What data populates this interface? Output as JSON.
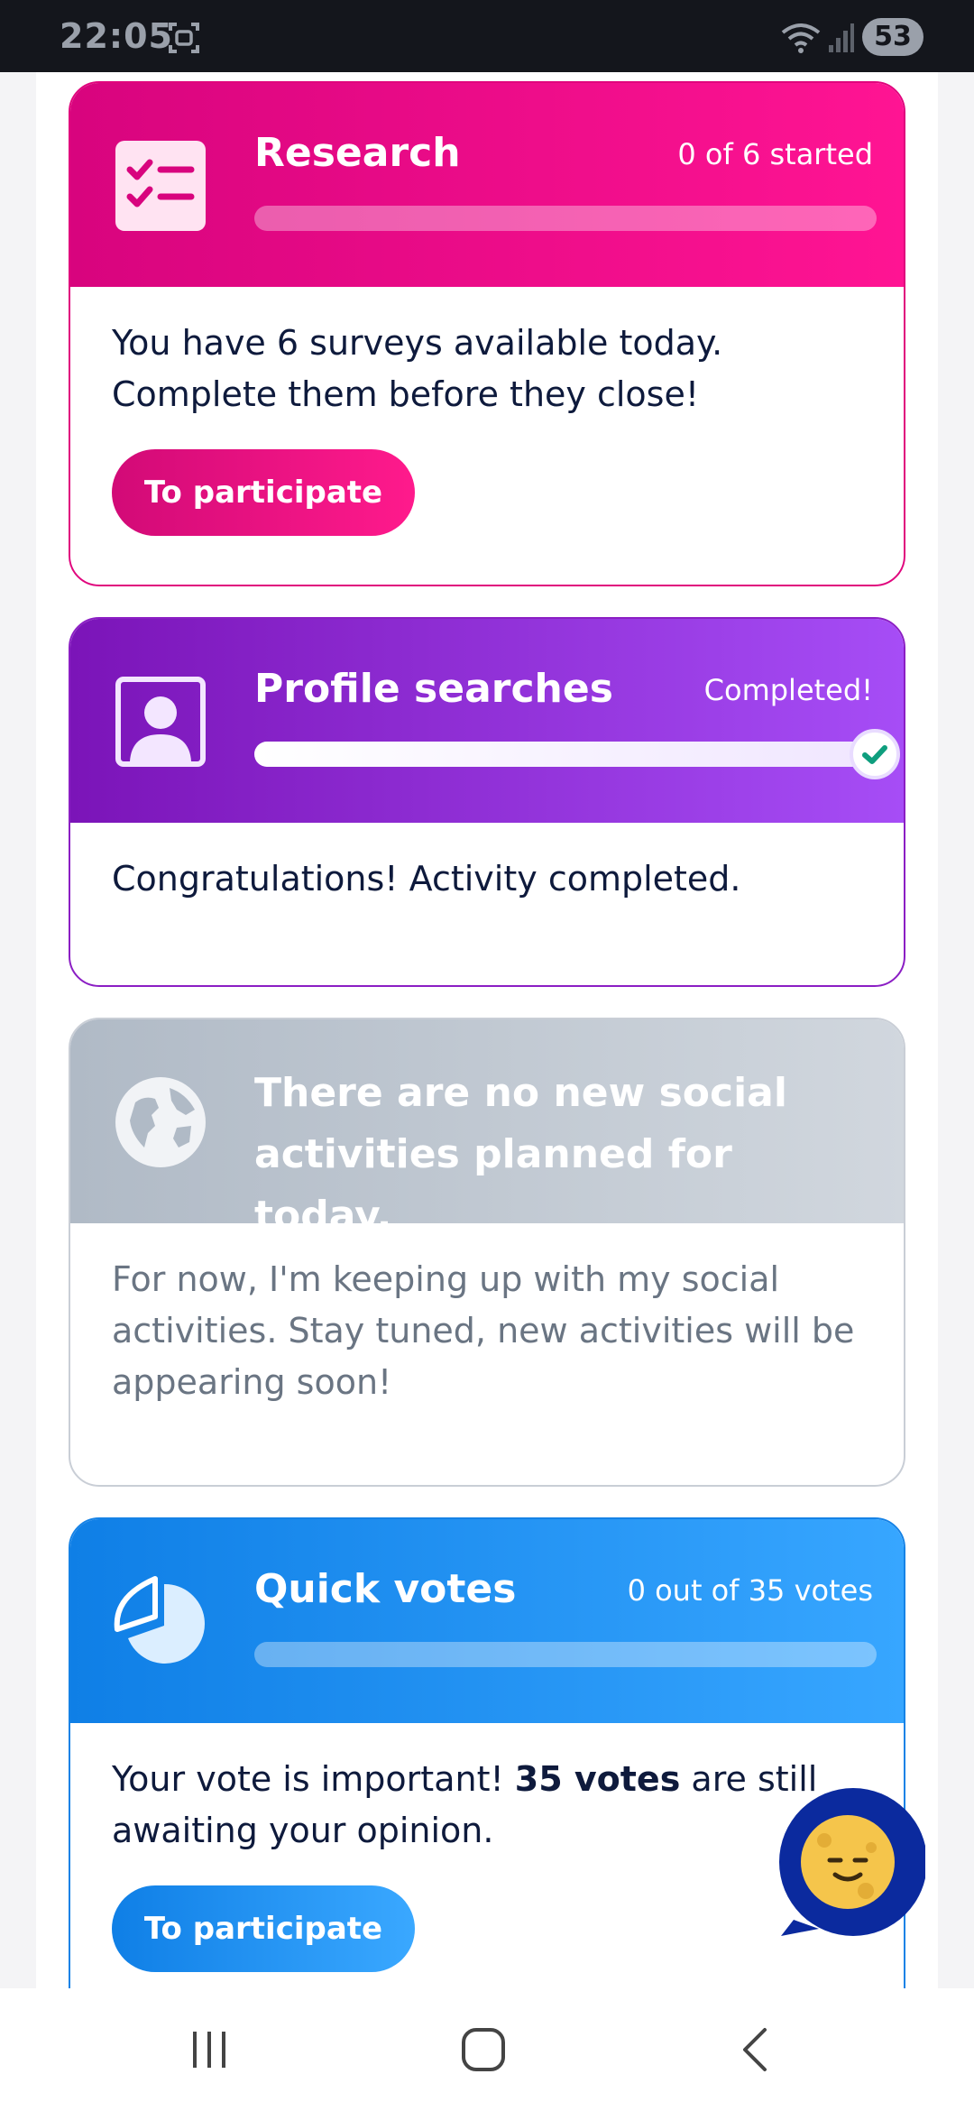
{
  "status_bar": {
    "time": "22:05",
    "battery": "53",
    "icons": [
      "screenshot-icon",
      "wifi-icon",
      "signal-icon"
    ]
  },
  "colors": {
    "research": "#e0057d",
    "profile": "#8b1ec4",
    "social": "#b0bac6",
    "votes": "#1582e6"
  },
  "cards": {
    "research": {
      "icon": "checklist-icon",
      "title": "Research",
      "status": "0 of 6 started",
      "progress": 0,
      "body": "You have 6 surveys available today. Complete them before they close!",
      "button": "To participate"
    },
    "profile": {
      "icon": "profile-icon",
      "title": "Profile searches",
      "status": "Completed!",
      "progress": 1,
      "body": "Congratulations! Activity completed."
    },
    "social": {
      "icon": "globe-icon",
      "title": "There are no new social activities planned for today.",
      "body": "For now, I'm keeping up with my social activities. Stay tuned, new activities will be appearing soon!"
    },
    "votes": {
      "icon": "pie-chart-icon",
      "title": "Quick votes",
      "status": "0 out of 35 votes",
      "progress": 0,
      "body_before": "Your vote is important! ",
      "body_strong": "35 votes",
      "body_after": " are still awaiting your opinion.",
      "button": "To participate"
    }
  },
  "chat": {
    "icon": "chat-assistant-icon"
  },
  "nav": {
    "icons": [
      "recent-apps-icon",
      "home-icon",
      "back-icon"
    ]
  }
}
